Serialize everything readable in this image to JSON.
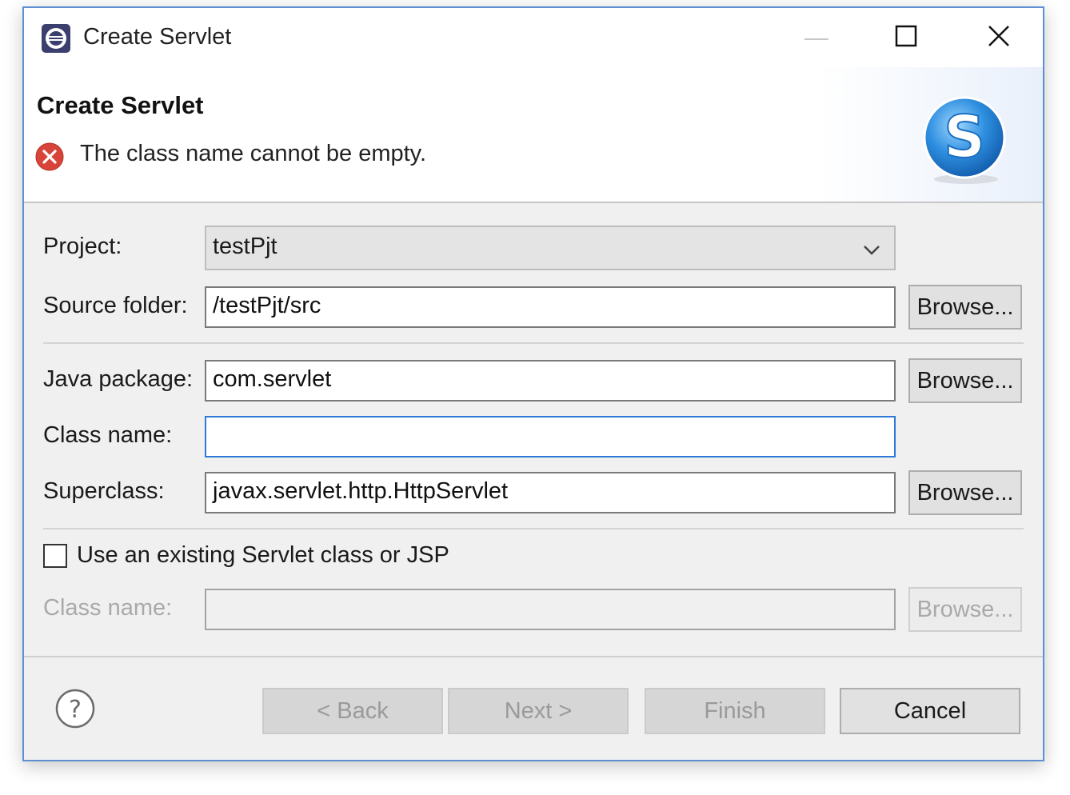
{
  "window": {
    "title": "Create Servlet",
    "controls": [
      "minimize-icon",
      "maximize-icon",
      "close-icon"
    ]
  },
  "header": {
    "title": "Create Servlet",
    "message": "The class name cannot be empty.",
    "message_icon": "error-icon",
    "banner_icon": "servlet-s-logo"
  },
  "form": {
    "project": {
      "label": "Project:",
      "value": "testPjt"
    },
    "source_folder": {
      "label": "Source folder:",
      "value": "/testPjt/src",
      "browse": "Browse..."
    },
    "java_package": {
      "label": "Java package:",
      "value": "com.servlet",
      "browse": "Browse..."
    },
    "class_name": {
      "label": "Class name:",
      "value": ""
    },
    "superclass": {
      "label": "Superclass:",
      "value": "javax.servlet.http.HttpServlet",
      "browse": "Browse..."
    },
    "use_existing": {
      "label": "Use an existing Servlet class or JSP",
      "checked": false
    },
    "existing_class_name": {
      "label": "Class name:",
      "value": "",
      "browse": "Browse..."
    }
  },
  "footer": {
    "help_icon": "help-icon",
    "back": "< Back",
    "next": "Next >",
    "finish": "Finish",
    "cancel": "Cancel"
  },
  "colors": {
    "accent": "#2c7ad6",
    "error": "#d9443a",
    "window_border": "#5f8fd0"
  }
}
